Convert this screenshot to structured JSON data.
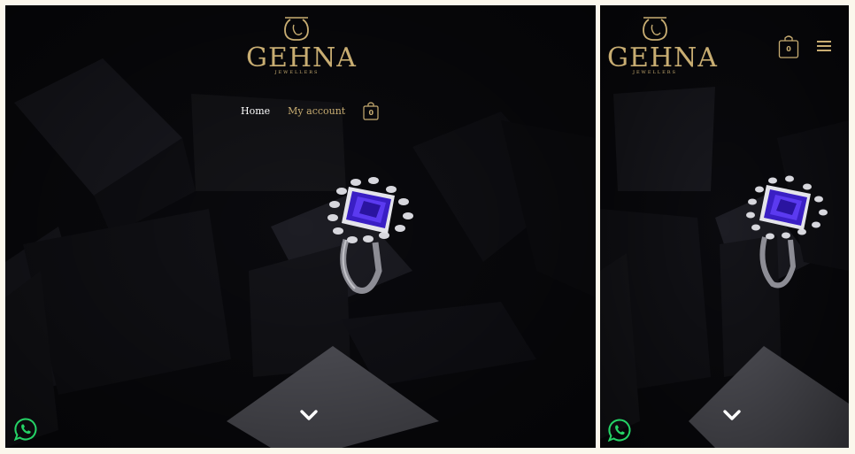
{
  "brand": {
    "name": "GEHNA",
    "sub": "JEWELLERS"
  },
  "nav": {
    "home": "Home",
    "account": "My account"
  },
  "cart": {
    "count": "0",
    "icon": "shopping-bag-icon"
  },
  "icons": {
    "scroll": "chevron-down-icon",
    "whatsapp": "whatsapp-icon",
    "menu": "hamburger-menu-icon"
  },
  "colors": {
    "gold": "#c8ad72",
    "background": "#07070a",
    "whatsapp": "#25d366"
  }
}
